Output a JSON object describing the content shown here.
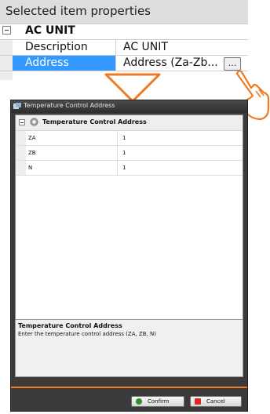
{
  "properties_panel": {
    "title": "Selected item properties",
    "category": "AC UNIT",
    "rows": [
      {
        "name": "Description",
        "value": "AC UNIT"
      },
      {
        "name": "Address",
        "value": "Address (Za-Zb...",
        "button": "..."
      }
    ]
  },
  "dialog": {
    "title": "Temperature Control Address",
    "category": "Temperature Control Address",
    "rows": [
      {
        "name": "ZA",
        "value": "1"
      },
      {
        "name": "ZB",
        "value": "1"
      },
      {
        "name": "N",
        "value": "1"
      }
    ],
    "description": {
      "title": "Temperature Control Address",
      "text": "Enter the temperature control address (ZA, ZB, N)"
    },
    "confirm_label": "Confirm",
    "cancel_label": "Cancel"
  },
  "colors": {
    "selection": "#3399ff",
    "accent": "#f07a22",
    "dialog_frame": "#3a3a3a"
  }
}
